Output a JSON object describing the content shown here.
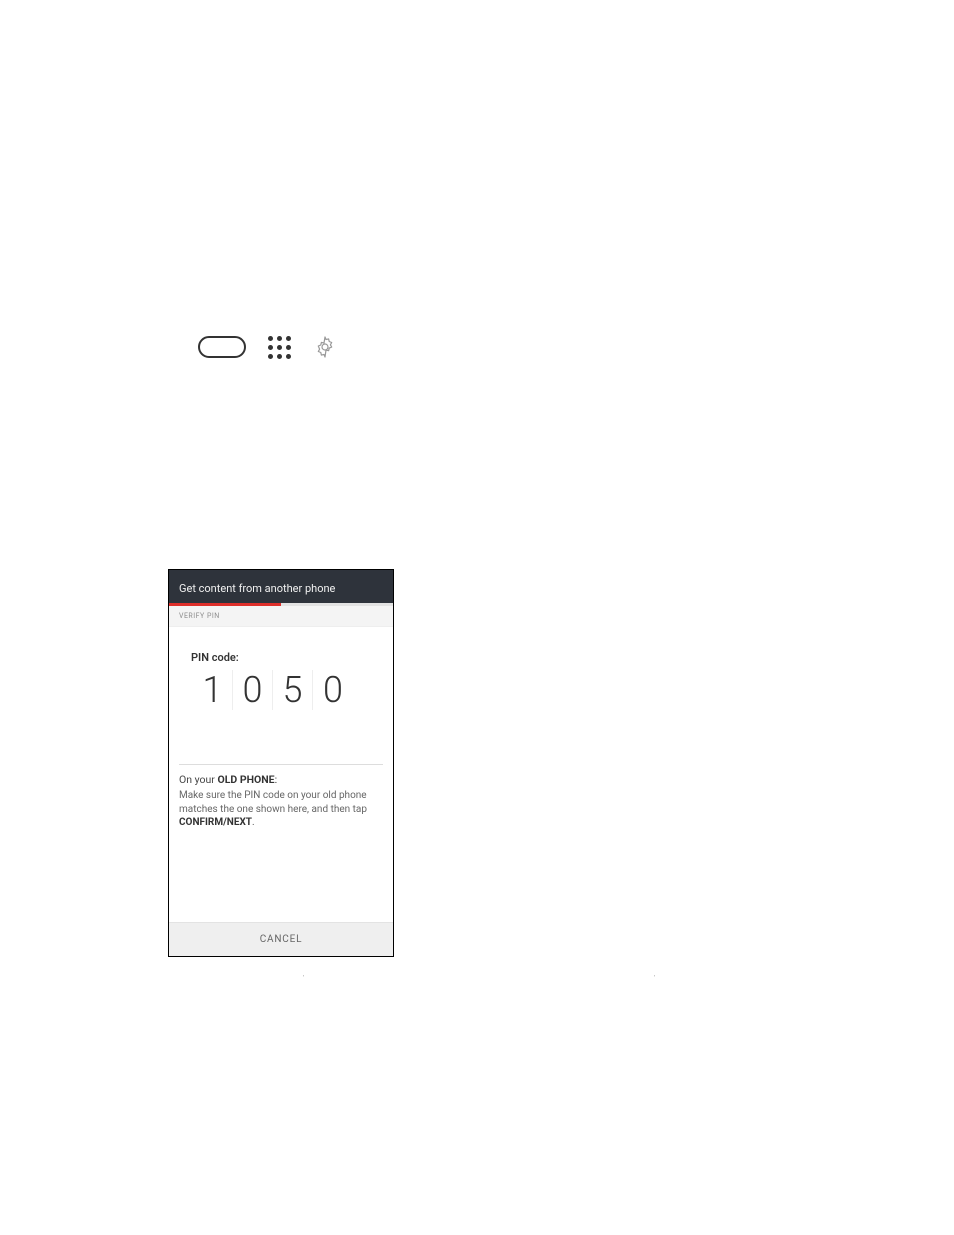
{
  "icons": {
    "pill": "pill-shape",
    "grid": "grid-dots",
    "gear": "gear"
  },
  "phone": {
    "title": "Get content from another phone",
    "step_label": "VERIFY PIN",
    "pin_label": "PIN code:",
    "pin_digits": [
      "1",
      "0",
      "5",
      "0"
    ],
    "instructions": {
      "prefix": "On your ",
      "bold1": "OLD PHONE",
      "after_bold1": ":",
      "body_before": "Make sure the PIN code on your old phone matches the one shown here, and then tap ",
      "bold2": "CONFIRM/NEXT",
      "body_after": "."
    },
    "cancel": "CANCEL"
  }
}
